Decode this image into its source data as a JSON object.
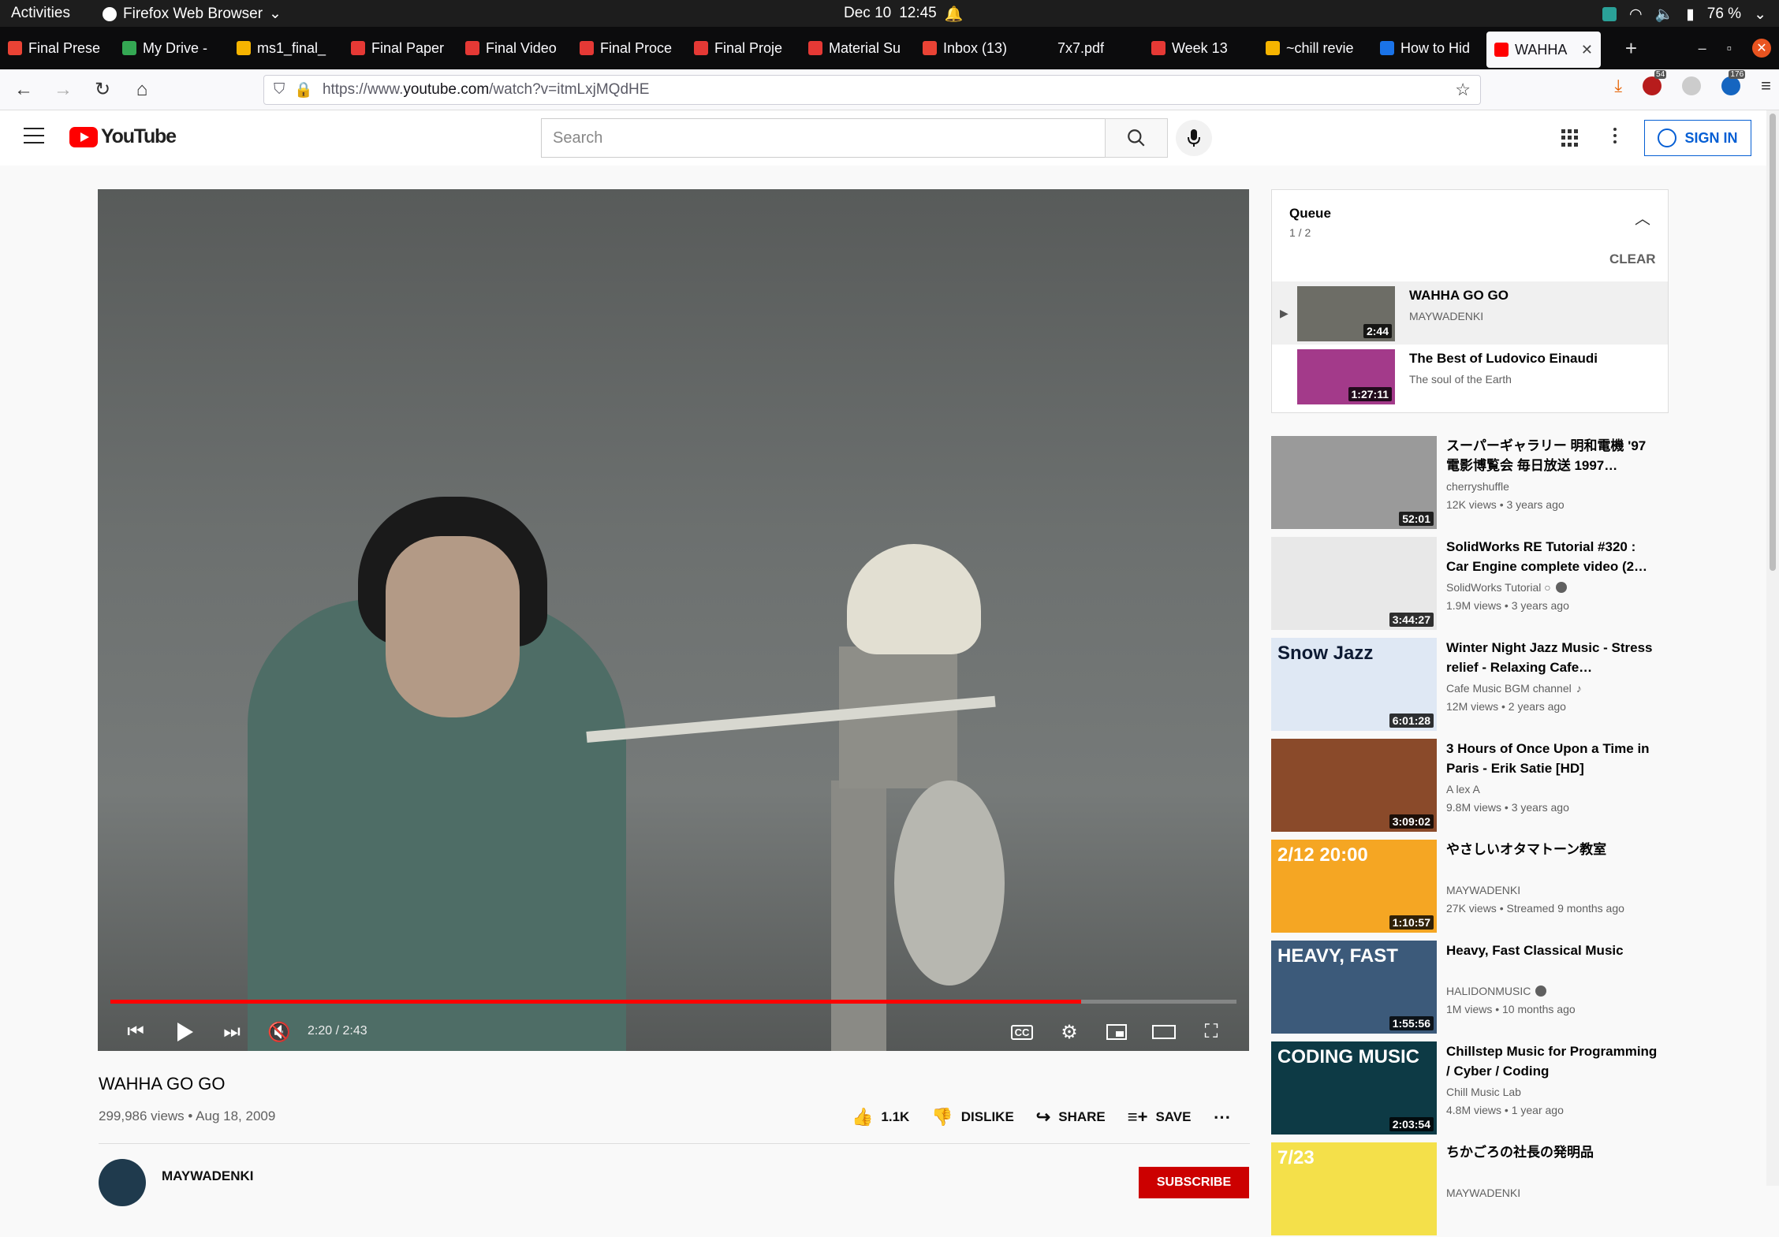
{
  "os": {
    "activities": "Activities",
    "app": "Firefox Web Browser",
    "date": "Dec 10",
    "time": "12:45",
    "battery": "76 %"
  },
  "tabs": [
    {
      "label": "Final Prese",
      "color": "#ea4335"
    },
    {
      "label": "My Drive -",
      "color": "#34a853"
    },
    {
      "label": "ms1_final_",
      "color": "#f6b400"
    },
    {
      "label": "Final Paper",
      "color": "#e53935"
    },
    {
      "label": "Final Video",
      "color": "#e53935"
    },
    {
      "label": "Final Proce",
      "color": "#e53935"
    },
    {
      "label": "Final Proje",
      "color": "#e53935"
    },
    {
      "label": "Material Su",
      "color": "#e53935"
    },
    {
      "label": "Inbox (13)",
      "color": "#ea4335"
    },
    {
      "label": "7x7.pdf",
      "color": "#0c0c0d"
    },
    {
      "label": "Week 13",
      "color": "#e53935"
    },
    {
      "label": "~chill revie",
      "color": "#f6b400"
    },
    {
      "label": "How to Hid",
      "color": "#1a73e8"
    },
    {
      "label": "WAHHA",
      "color": "#ff0000"
    }
  ],
  "url": {
    "prefix": "https://www.",
    "domain": "youtube.com",
    "path": "/watch?v=itmLxjMQdHE"
  },
  "ext": {
    "b1": "54",
    "b2": "176"
  },
  "yt": {
    "logo": "YouTube",
    "search_placeholder": "Search",
    "signin": "SIGN IN"
  },
  "video": {
    "title": "WAHHA GO GO",
    "views": "299,986 views",
    "date": "Aug 18, 2009",
    "time": "2:20 / 2:43",
    "progress": 0.862,
    "buffered": 0.86
  },
  "actions": {
    "like": "1.1K",
    "dislike": "DISLIKE",
    "share": "SHARE",
    "save": "SAVE"
  },
  "owner": {
    "name": "MAYWADENKI",
    "subscribe": "SUBSCRIBE"
  },
  "queue": {
    "title": "Queue",
    "count": "1 / 2",
    "clear": "CLEAR",
    "items": [
      {
        "title": "WAHHA GO GO",
        "channel": "MAYWADENKI",
        "duration": "2:44",
        "thumb": "#6d6d66"
      },
      {
        "title": "The Best of Ludovico Einaudi",
        "channel": "The soul of the Earth",
        "duration": "1:27:11",
        "thumb": "#a33a8a"
      }
    ]
  },
  "recs": [
    {
      "title": "スーパーギャラリー 明和電機 '97電影博覧会 毎日放送 1997…",
      "channel": "cherryshuffle",
      "meta": "12K views • 3 years ago",
      "duration": "52:01",
      "thumb": "#9a9a9a"
    },
    {
      "title": "SolidWorks RE Tutorial #320 : Car Engine complete video (2…",
      "channel": "SolidWorks Tutorial ○",
      "meta": "1.9M views • 3 years ago",
      "duration": "3:44:27",
      "thumb": "#e8e8e8"
    },
    {
      "title": "Winter Night Jazz Music - Stress relief - Relaxing Cafe…",
      "channel": "Cafe Music BGM channel",
      "meta": "12M views • 2 years ago",
      "duration": "6:01:28",
      "thumb": "#dfe8f4",
      "overlay": "Snow Jazz"
    },
    {
      "title": "3 Hours of Once Upon a Time in Paris - Erik Satie [HD]",
      "channel": "A lex A",
      "meta": "9.8M views • 3 years ago",
      "duration": "3:09:02",
      "thumb": "#8a4a2a"
    },
    {
      "title": "やさしいオタマトーン教室",
      "channel": "MAYWADENKI",
      "meta": "27K views • Streamed 9 months ago",
      "duration": "1:10:57",
      "thumb": "#f5a623",
      "overlay": "2/12 20:00"
    },
    {
      "title": "Heavy, Fast Classical Music",
      "channel": "HALIDONMUSIC",
      "meta": "1M views • 10 months ago",
      "duration": "1:55:56",
      "thumb": "#3c5a7a",
      "overlay": "HEAVY, FAST"
    },
    {
      "title": "Chillstep Music for Programming / Cyber / Coding",
      "channel": "Chill Music Lab",
      "meta": "4.8M views • 1 year ago",
      "duration": "2:03:54",
      "thumb": "#0d3a45",
      "overlay": "CODING MUSIC"
    },
    {
      "title": "ちかごろの社長の発明品",
      "channel": "MAYWADENKI",
      "meta": "",
      "duration": "",
      "thumb": "#f4e04a",
      "overlay": "7/23"
    }
  ]
}
